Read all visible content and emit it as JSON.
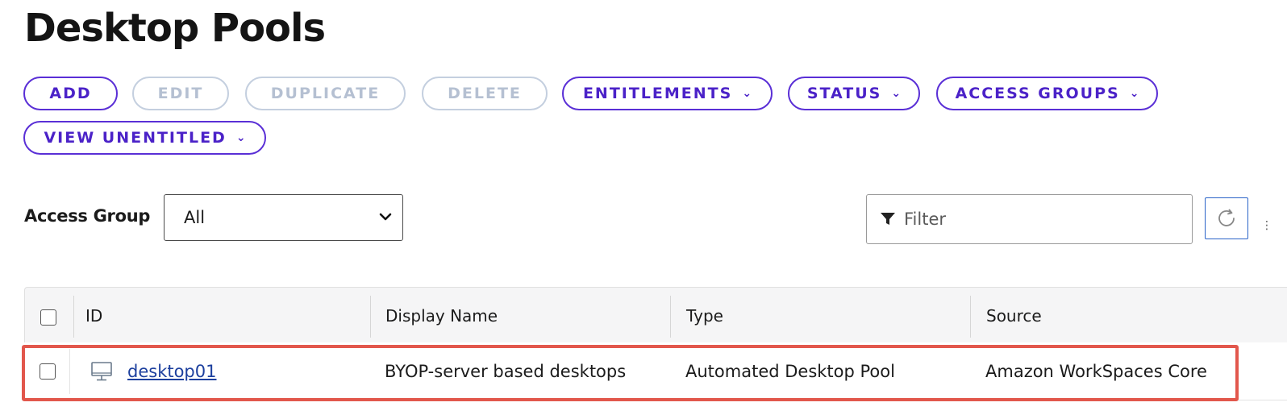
{
  "page": {
    "title": "Desktop Pools"
  },
  "toolbar": {
    "buttons": [
      {
        "label": "ADD",
        "enabled": true,
        "dropdown": false
      },
      {
        "label": "EDIT",
        "enabled": false,
        "dropdown": false
      },
      {
        "label": "DUPLICATE",
        "enabled": false,
        "dropdown": false
      },
      {
        "label": "DELETE",
        "enabled": false,
        "dropdown": false
      },
      {
        "label": "ENTITLEMENTS",
        "enabled": true,
        "dropdown": true
      },
      {
        "label": "STATUS",
        "enabled": true,
        "dropdown": true
      },
      {
        "label": "ACCESS GROUPS",
        "enabled": true,
        "dropdown": true
      },
      {
        "label": "VIEW UNENTITLED",
        "enabled": true,
        "dropdown": true
      }
    ],
    "accent_color": "#4b22c8",
    "disabled_color": "#b5c0d2"
  },
  "filters": {
    "access_group_label": "Access Group",
    "access_group_value": "All",
    "filter_placeholder": "Filter",
    "filter_value": ""
  },
  "table": {
    "columns": [
      "ID",
      "Display Name",
      "Type",
      "Source"
    ],
    "rows": [
      {
        "id": "desktop01",
        "display_name": "BYOP-server based desktops",
        "type": "Automated Desktop Pool",
        "source": "Amazon WorkSpaces Core",
        "icon": "desktop-monitor-icon",
        "selected": false,
        "highlighted": true
      }
    ],
    "highlight_color": "#e2574c"
  },
  "icons": {
    "filter": "funnel-icon",
    "refresh": "refresh-icon",
    "dropdown": "chevron-down-icon"
  }
}
